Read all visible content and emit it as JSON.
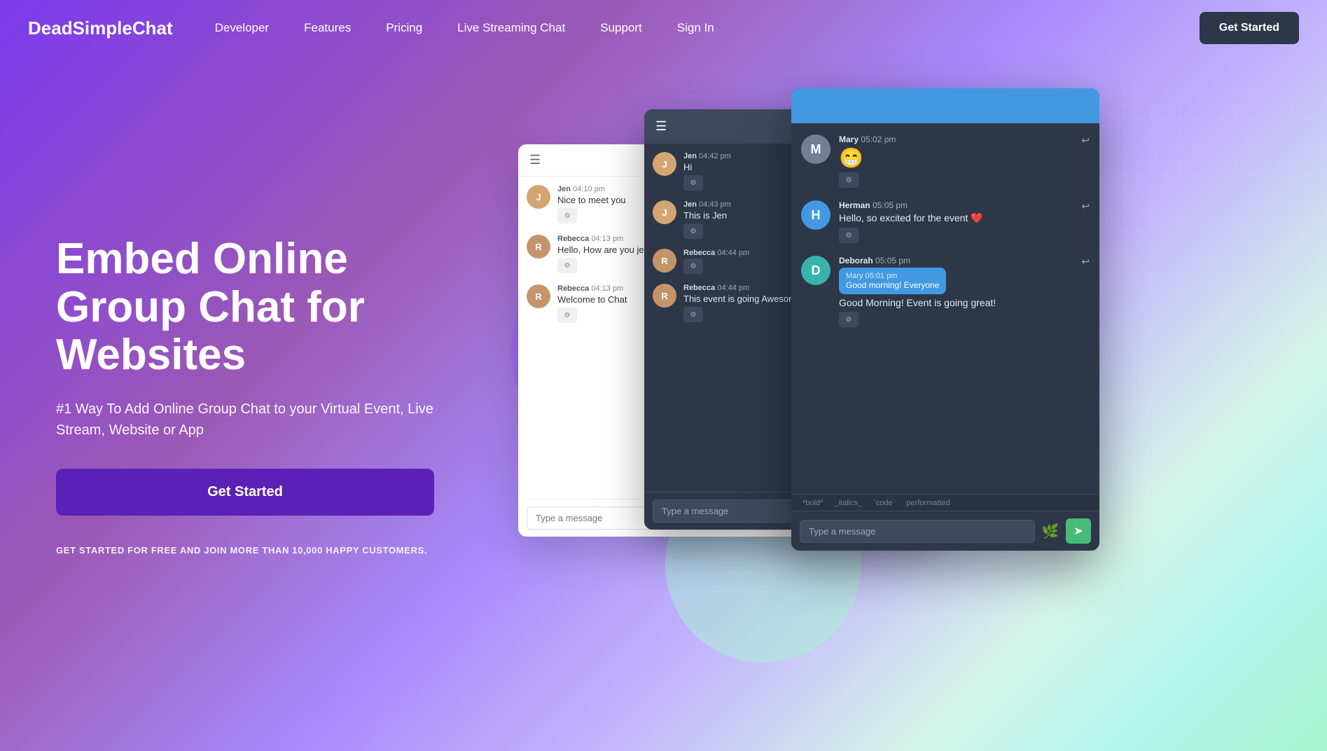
{
  "brand": {
    "name": "DeadSimpleChat"
  },
  "nav": {
    "items": [
      {
        "label": "Developer",
        "href": "#"
      },
      {
        "label": "Features",
        "href": "#"
      },
      {
        "label": "Pricing",
        "href": "#"
      },
      {
        "label": "Live Streaming Chat",
        "href": "#"
      },
      {
        "label": "Support",
        "href": "#"
      },
      {
        "label": "Sign In",
        "href": "#"
      }
    ],
    "cta": "Get Started"
  },
  "hero": {
    "headline": "Embed Online Group Chat for Websites",
    "subheadline": "#1 Way To Add Online Group Chat to your Virtual Event, Live Stream, Website or App",
    "cta_button": "Get Started",
    "note": "GET STARTED FOR FREE AND JOIN MORE THAN 10,000 HAPPY CUSTOMERS."
  },
  "chat1": {
    "messages": [
      {
        "user": "Jen",
        "time": "04:10 pm",
        "text": "Nice to meet you"
      },
      {
        "user": "Rebecca",
        "time": "04:13 pm",
        "text": "Hello, How are you jen?"
      },
      {
        "user": "Rebecca",
        "time": "04:13 pm",
        "text": "Welcome to Chat"
      }
    ],
    "input_placeholder": "Type a message"
  },
  "chat2": {
    "messages": [
      {
        "user": "Jen",
        "time": "04:42 pm",
        "text": "Hi"
      },
      {
        "user": "Jen",
        "time": "04:43 pm",
        "text": "This is Jen"
      },
      {
        "user": "Rebecca",
        "time": "04:44 pm",
        "text": ""
      },
      {
        "user": "Rebecca",
        "time": "04:44 pm",
        "text": "This event is going Awesome"
      }
    ],
    "input_placeholder": "Type a message"
  },
  "chat3": {
    "messages": [
      {
        "user": "Mary",
        "time": "05:02 pm",
        "text": ""
      },
      {
        "user": "Herman",
        "time": "05:05 pm",
        "text": "Hello, so excited for the event ❤️"
      },
      {
        "user": "Deborah",
        "time": "05:05 pm",
        "reply_user": "Mary",
        "reply_time": "05:01 pm",
        "reply_text": "Good morning! Everyone",
        "text": "Good Morning! Event is going great!"
      }
    ],
    "input_placeholder": "Type a message",
    "toolbar_items": [
      "*bold*",
      "_italics_",
      "`code`",
      "performatted"
    ]
  },
  "colors": {
    "hero_gradient_start": "#7c3aed",
    "hero_gradient_end": "#a7f3d0",
    "cta_bg": "#5b21b6",
    "get_started_btn": "#2d3748",
    "chat_dark_bg": "#2d3748",
    "chat_accent": "#4299e1",
    "send_btn": "#48bb78"
  }
}
